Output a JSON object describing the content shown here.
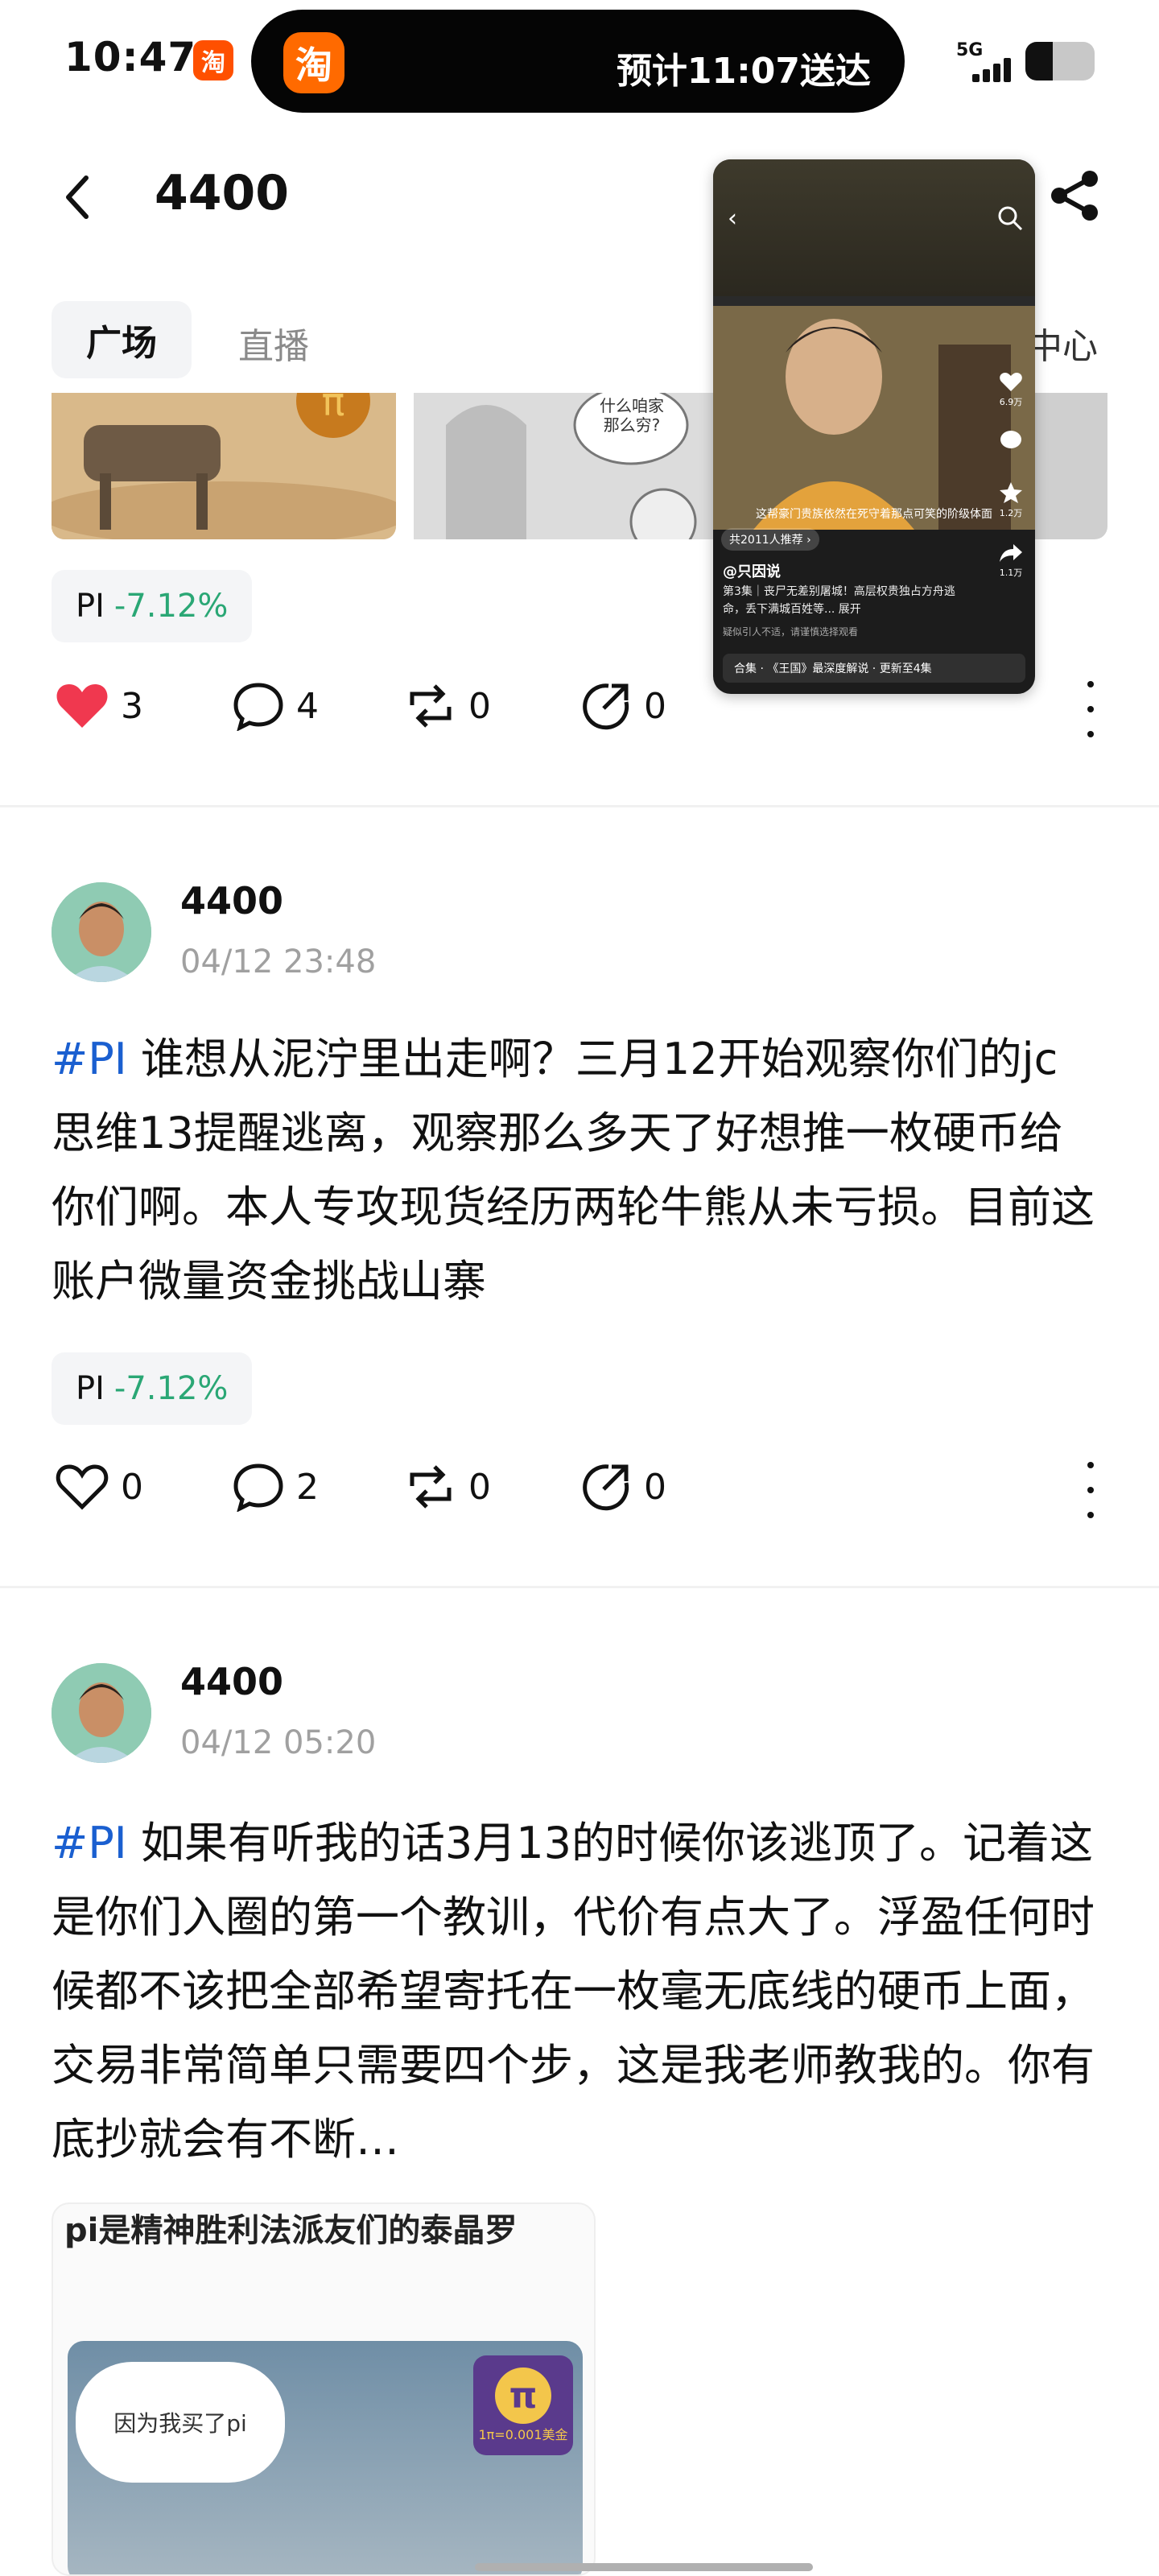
{
  "status_bar": {
    "time": "10:47",
    "small_app_icon": "淘",
    "island_app_icon": "淘",
    "island_text": "预计11:07送达",
    "network": "5G"
  },
  "header": {
    "title": "4400"
  },
  "tabs": {
    "items": [
      "广场",
      "直播"
    ],
    "right_label": "中心"
  },
  "floating_video": {
    "subtitle": "这帮豪门贵族依然在死守着那点可笑的阶级体面",
    "recommend": "共2011人推荐 ›",
    "author": "@只因说",
    "description": "第3集｜丧尸无差别屠城！高层权贵独占方舟逃命，丢下满城百姓等... 展开",
    "hint": "疑似引人不适，请谨慎选择观看",
    "collection": "合集 · 《王国》最深度解说 · 更新至4集",
    "side_likes": "6.9万",
    "side_stars": "1.2万",
    "side_shares": "1.1万"
  },
  "posts": [
    {
      "tag": {
        "symbol": "PI",
        "change": "-7.12%"
      },
      "likes": "3",
      "comments": "4",
      "reposts": "0",
      "shares": "0",
      "liked": true,
      "image_text": "什么咱家那么穷?"
    },
    {
      "author": "4400",
      "time": "04/12 23:48",
      "hashtag": "#PI",
      "text": " 谁想从泥泞里出走啊？三月12开始观察你们的jc思维13提醒逃离，观察那么多天了好想推一枚硬币给你们啊。本人专攻现货经历两轮牛熊从未亏损。目前这账户微量资金挑战山寨",
      "tag": {
        "symbol": "PI",
        "change": "-7.12%"
      },
      "likes": "0",
      "comments": "2",
      "reposts": "0",
      "shares": "0"
    },
    {
      "author": "4400",
      "time": "04/12 05:20",
      "hashtag": "#PI",
      "text": " 如果有听我的话3月13的时候你该逃顶了。记着这是你们入圈的第一个教训，代价有点大了。浮盈任何时候都不该把全部希望寄托在一枚毫无底线的硬币上面，交易非常简单只需要四个步，这是我老师教我的。你有底抄就会有不断…",
      "image_caption": "pi是精神胜利法派友们的泰晶罗",
      "image_bubble": "因为我买了pi",
      "pi_badge_text": "1π=0.001美金"
    }
  ],
  "colors": {
    "hashtag": "#1a5fd0",
    "change_negative": "#2aa775",
    "like_active": "#f0384f",
    "accent_taobao": "#ff5000"
  }
}
